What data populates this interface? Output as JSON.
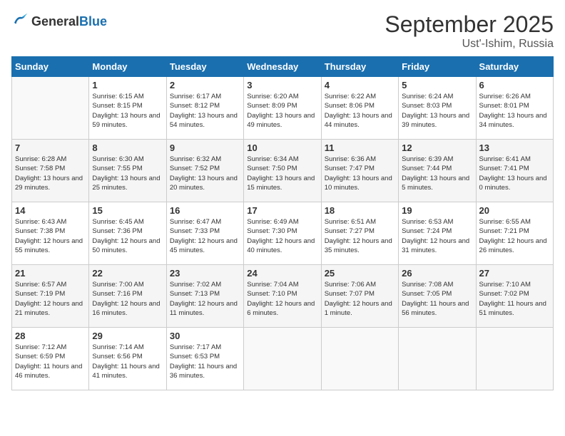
{
  "logo": {
    "general": "General",
    "blue": "Blue"
  },
  "header": {
    "month": "September 2025",
    "location": "Ust'-Ishim, Russia"
  },
  "days_of_week": [
    "Sunday",
    "Monday",
    "Tuesday",
    "Wednesday",
    "Thursday",
    "Friday",
    "Saturday"
  ],
  "weeks": [
    [
      {
        "day": "",
        "sunrise": "",
        "sunset": "",
        "daylight": ""
      },
      {
        "day": "1",
        "sunrise": "Sunrise: 6:15 AM",
        "sunset": "Sunset: 8:15 PM",
        "daylight": "Daylight: 13 hours and 59 minutes."
      },
      {
        "day": "2",
        "sunrise": "Sunrise: 6:17 AM",
        "sunset": "Sunset: 8:12 PM",
        "daylight": "Daylight: 13 hours and 54 minutes."
      },
      {
        "day": "3",
        "sunrise": "Sunrise: 6:20 AM",
        "sunset": "Sunset: 8:09 PM",
        "daylight": "Daylight: 13 hours and 49 minutes."
      },
      {
        "day": "4",
        "sunrise": "Sunrise: 6:22 AM",
        "sunset": "Sunset: 8:06 PM",
        "daylight": "Daylight: 13 hours and 44 minutes."
      },
      {
        "day": "5",
        "sunrise": "Sunrise: 6:24 AM",
        "sunset": "Sunset: 8:03 PM",
        "daylight": "Daylight: 13 hours and 39 minutes."
      },
      {
        "day": "6",
        "sunrise": "Sunrise: 6:26 AM",
        "sunset": "Sunset: 8:01 PM",
        "daylight": "Daylight: 13 hours and 34 minutes."
      }
    ],
    [
      {
        "day": "7",
        "sunrise": "Sunrise: 6:28 AM",
        "sunset": "Sunset: 7:58 PM",
        "daylight": "Daylight: 13 hours and 29 minutes."
      },
      {
        "day": "8",
        "sunrise": "Sunrise: 6:30 AM",
        "sunset": "Sunset: 7:55 PM",
        "daylight": "Daylight: 13 hours and 25 minutes."
      },
      {
        "day": "9",
        "sunrise": "Sunrise: 6:32 AM",
        "sunset": "Sunset: 7:52 PM",
        "daylight": "Daylight: 13 hours and 20 minutes."
      },
      {
        "day": "10",
        "sunrise": "Sunrise: 6:34 AM",
        "sunset": "Sunset: 7:50 PM",
        "daylight": "Daylight: 13 hours and 15 minutes."
      },
      {
        "day": "11",
        "sunrise": "Sunrise: 6:36 AM",
        "sunset": "Sunset: 7:47 PM",
        "daylight": "Daylight: 13 hours and 10 minutes."
      },
      {
        "day": "12",
        "sunrise": "Sunrise: 6:39 AM",
        "sunset": "Sunset: 7:44 PM",
        "daylight": "Daylight: 13 hours and 5 minutes."
      },
      {
        "day": "13",
        "sunrise": "Sunrise: 6:41 AM",
        "sunset": "Sunset: 7:41 PM",
        "daylight": "Daylight: 13 hours and 0 minutes."
      }
    ],
    [
      {
        "day": "14",
        "sunrise": "Sunrise: 6:43 AM",
        "sunset": "Sunset: 7:38 PM",
        "daylight": "Daylight: 12 hours and 55 minutes."
      },
      {
        "day": "15",
        "sunrise": "Sunrise: 6:45 AM",
        "sunset": "Sunset: 7:36 PM",
        "daylight": "Daylight: 12 hours and 50 minutes."
      },
      {
        "day": "16",
        "sunrise": "Sunrise: 6:47 AM",
        "sunset": "Sunset: 7:33 PM",
        "daylight": "Daylight: 12 hours and 45 minutes."
      },
      {
        "day": "17",
        "sunrise": "Sunrise: 6:49 AM",
        "sunset": "Sunset: 7:30 PM",
        "daylight": "Daylight: 12 hours and 40 minutes."
      },
      {
        "day": "18",
        "sunrise": "Sunrise: 6:51 AM",
        "sunset": "Sunset: 7:27 PM",
        "daylight": "Daylight: 12 hours and 35 minutes."
      },
      {
        "day": "19",
        "sunrise": "Sunrise: 6:53 AM",
        "sunset": "Sunset: 7:24 PM",
        "daylight": "Daylight: 12 hours and 31 minutes."
      },
      {
        "day": "20",
        "sunrise": "Sunrise: 6:55 AM",
        "sunset": "Sunset: 7:21 PM",
        "daylight": "Daylight: 12 hours and 26 minutes."
      }
    ],
    [
      {
        "day": "21",
        "sunrise": "Sunrise: 6:57 AM",
        "sunset": "Sunset: 7:19 PM",
        "daylight": "Daylight: 12 hours and 21 minutes."
      },
      {
        "day": "22",
        "sunrise": "Sunrise: 7:00 AM",
        "sunset": "Sunset: 7:16 PM",
        "daylight": "Daylight: 12 hours and 16 minutes."
      },
      {
        "day": "23",
        "sunrise": "Sunrise: 7:02 AM",
        "sunset": "Sunset: 7:13 PM",
        "daylight": "Daylight: 12 hours and 11 minutes."
      },
      {
        "day": "24",
        "sunrise": "Sunrise: 7:04 AM",
        "sunset": "Sunset: 7:10 PM",
        "daylight": "Daylight: 12 hours and 6 minutes."
      },
      {
        "day": "25",
        "sunrise": "Sunrise: 7:06 AM",
        "sunset": "Sunset: 7:07 PM",
        "daylight": "Daylight: 12 hours and 1 minute."
      },
      {
        "day": "26",
        "sunrise": "Sunrise: 7:08 AM",
        "sunset": "Sunset: 7:05 PM",
        "daylight": "Daylight: 11 hours and 56 minutes."
      },
      {
        "day": "27",
        "sunrise": "Sunrise: 7:10 AM",
        "sunset": "Sunset: 7:02 PM",
        "daylight": "Daylight: 11 hours and 51 minutes."
      }
    ],
    [
      {
        "day": "28",
        "sunrise": "Sunrise: 7:12 AM",
        "sunset": "Sunset: 6:59 PM",
        "daylight": "Daylight: 11 hours and 46 minutes."
      },
      {
        "day": "29",
        "sunrise": "Sunrise: 7:14 AM",
        "sunset": "Sunset: 6:56 PM",
        "daylight": "Daylight: 11 hours and 41 minutes."
      },
      {
        "day": "30",
        "sunrise": "Sunrise: 7:17 AM",
        "sunset": "Sunset: 6:53 PM",
        "daylight": "Daylight: 11 hours and 36 minutes."
      },
      {
        "day": "",
        "sunrise": "",
        "sunset": "",
        "daylight": ""
      },
      {
        "day": "",
        "sunrise": "",
        "sunset": "",
        "daylight": ""
      },
      {
        "day": "",
        "sunrise": "",
        "sunset": "",
        "daylight": ""
      },
      {
        "day": "",
        "sunrise": "",
        "sunset": "",
        "daylight": ""
      }
    ]
  ]
}
